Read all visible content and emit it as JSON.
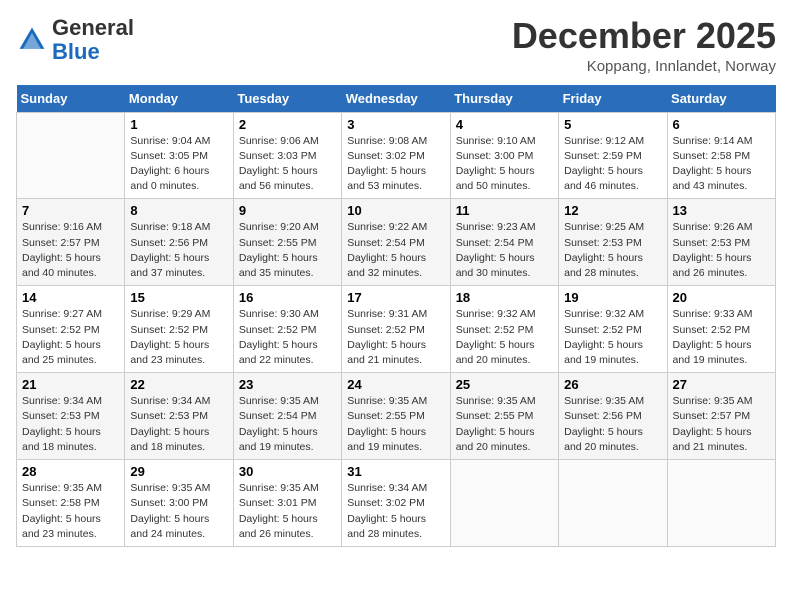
{
  "header": {
    "logo": {
      "general": "General",
      "blue": "Blue"
    },
    "title": "December 2025",
    "location": "Koppang, Innlandet, Norway"
  },
  "calendar": {
    "days_of_week": [
      "Sunday",
      "Monday",
      "Tuesday",
      "Wednesday",
      "Thursday",
      "Friday",
      "Saturday"
    ],
    "weeks": [
      [
        {
          "day": "",
          "info": ""
        },
        {
          "day": "1",
          "info": "Sunrise: 9:04 AM\nSunset: 3:05 PM\nDaylight: 6 hours\nand 0 minutes."
        },
        {
          "day": "2",
          "info": "Sunrise: 9:06 AM\nSunset: 3:03 PM\nDaylight: 5 hours\nand 56 minutes."
        },
        {
          "day": "3",
          "info": "Sunrise: 9:08 AM\nSunset: 3:02 PM\nDaylight: 5 hours\nand 53 minutes."
        },
        {
          "day": "4",
          "info": "Sunrise: 9:10 AM\nSunset: 3:00 PM\nDaylight: 5 hours\nand 50 minutes."
        },
        {
          "day": "5",
          "info": "Sunrise: 9:12 AM\nSunset: 2:59 PM\nDaylight: 5 hours\nand 46 minutes."
        },
        {
          "day": "6",
          "info": "Sunrise: 9:14 AM\nSunset: 2:58 PM\nDaylight: 5 hours\nand 43 minutes."
        }
      ],
      [
        {
          "day": "7",
          "info": "Sunrise: 9:16 AM\nSunset: 2:57 PM\nDaylight: 5 hours\nand 40 minutes."
        },
        {
          "day": "8",
          "info": "Sunrise: 9:18 AM\nSunset: 2:56 PM\nDaylight: 5 hours\nand 37 minutes."
        },
        {
          "day": "9",
          "info": "Sunrise: 9:20 AM\nSunset: 2:55 PM\nDaylight: 5 hours\nand 35 minutes."
        },
        {
          "day": "10",
          "info": "Sunrise: 9:22 AM\nSunset: 2:54 PM\nDaylight: 5 hours\nand 32 minutes."
        },
        {
          "day": "11",
          "info": "Sunrise: 9:23 AM\nSunset: 2:54 PM\nDaylight: 5 hours\nand 30 minutes."
        },
        {
          "day": "12",
          "info": "Sunrise: 9:25 AM\nSunset: 2:53 PM\nDaylight: 5 hours\nand 28 minutes."
        },
        {
          "day": "13",
          "info": "Sunrise: 9:26 AM\nSunset: 2:53 PM\nDaylight: 5 hours\nand 26 minutes."
        }
      ],
      [
        {
          "day": "14",
          "info": "Sunrise: 9:27 AM\nSunset: 2:52 PM\nDaylight: 5 hours\nand 25 minutes."
        },
        {
          "day": "15",
          "info": "Sunrise: 9:29 AM\nSunset: 2:52 PM\nDaylight: 5 hours\nand 23 minutes."
        },
        {
          "day": "16",
          "info": "Sunrise: 9:30 AM\nSunset: 2:52 PM\nDaylight: 5 hours\nand 22 minutes."
        },
        {
          "day": "17",
          "info": "Sunrise: 9:31 AM\nSunset: 2:52 PM\nDaylight: 5 hours\nand 21 minutes."
        },
        {
          "day": "18",
          "info": "Sunrise: 9:32 AM\nSunset: 2:52 PM\nDaylight: 5 hours\nand 20 minutes."
        },
        {
          "day": "19",
          "info": "Sunrise: 9:32 AM\nSunset: 2:52 PM\nDaylight: 5 hours\nand 19 minutes."
        },
        {
          "day": "20",
          "info": "Sunrise: 9:33 AM\nSunset: 2:52 PM\nDaylight: 5 hours\nand 19 minutes."
        }
      ],
      [
        {
          "day": "21",
          "info": "Sunrise: 9:34 AM\nSunset: 2:53 PM\nDaylight: 5 hours\nand 18 minutes."
        },
        {
          "day": "22",
          "info": "Sunrise: 9:34 AM\nSunset: 2:53 PM\nDaylight: 5 hours\nand 18 minutes."
        },
        {
          "day": "23",
          "info": "Sunrise: 9:35 AM\nSunset: 2:54 PM\nDaylight: 5 hours\nand 19 minutes."
        },
        {
          "day": "24",
          "info": "Sunrise: 9:35 AM\nSunset: 2:55 PM\nDaylight: 5 hours\nand 19 minutes."
        },
        {
          "day": "25",
          "info": "Sunrise: 9:35 AM\nSunset: 2:55 PM\nDaylight: 5 hours\nand 20 minutes."
        },
        {
          "day": "26",
          "info": "Sunrise: 9:35 AM\nSunset: 2:56 PM\nDaylight: 5 hours\nand 20 minutes."
        },
        {
          "day": "27",
          "info": "Sunrise: 9:35 AM\nSunset: 2:57 PM\nDaylight: 5 hours\nand 21 minutes."
        }
      ],
      [
        {
          "day": "28",
          "info": "Sunrise: 9:35 AM\nSunset: 2:58 PM\nDaylight: 5 hours\nand 23 minutes."
        },
        {
          "day": "29",
          "info": "Sunrise: 9:35 AM\nSunset: 3:00 PM\nDaylight: 5 hours\nand 24 minutes."
        },
        {
          "day": "30",
          "info": "Sunrise: 9:35 AM\nSunset: 3:01 PM\nDaylight: 5 hours\nand 26 minutes."
        },
        {
          "day": "31",
          "info": "Sunrise: 9:34 AM\nSunset: 3:02 PM\nDaylight: 5 hours\nand 28 minutes."
        },
        {
          "day": "",
          "info": ""
        },
        {
          "day": "",
          "info": ""
        },
        {
          "day": "",
          "info": ""
        }
      ]
    ]
  }
}
